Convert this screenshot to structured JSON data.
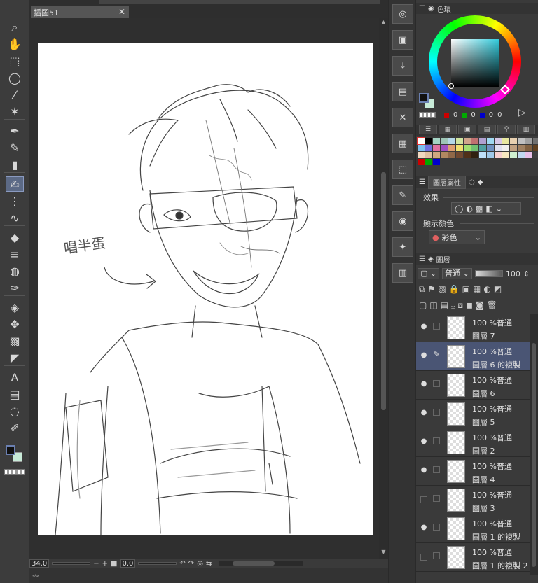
{
  "document": {
    "tab_title": "插圖51",
    "close_glyph": "✕"
  },
  "tools": [
    {
      "name": "zoom-icon",
      "glyph": "⌕"
    },
    {
      "name": "hand-icon",
      "glyph": "✋"
    },
    {
      "name": "object-select-icon",
      "glyph": "⬚"
    },
    {
      "name": "lasso-icon",
      "glyph": "◯"
    },
    {
      "name": "eyedropper-icon",
      "glyph": "⁄"
    },
    {
      "name": "auto-select-icon",
      "glyph": "✶"
    },
    {
      "name": "pen-icon",
      "glyph": "✒"
    },
    {
      "name": "pencil-icon",
      "glyph": "✎"
    },
    {
      "name": "brush-icon",
      "glyph": "▮"
    },
    {
      "name": "marker-icon",
      "glyph": "✍"
    },
    {
      "name": "airbrush-icon",
      "glyph": "⋮"
    },
    {
      "name": "decoration-icon",
      "glyph": "∿"
    },
    {
      "name": "eraser-icon",
      "glyph": "◆"
    },
    {
      "name": "blend-icon",
      "glyph": "≡"
    },
    {
      "name": "fill-icon",
      "glyph": "◍"
    },
    {
      "name": "vector-pen-icon",
      "glyph": "✑"
    },
    {
      "name": "fill-bucket-icon",
      "glyph": "◈"
    },
    {
      "name": "move-icon",
      "glyph": "✥"
    },
    {
      "name": "gradient-icon",
      "glyph": "▩"
    },
    {
      "name": "figure-icon",
      "glyph": "◤"
    },
    {
      "name": "text-icon",
      "glyph": "A"
    },
    {
      "name": "frame-icon",
      "glyph": "▤"
    },
    {
      "name": "balloon-icon",
      "glyph": "◌"
    },
    {
      "name": "correct-line-icon",
      "glyph": "✐"
    }
  ],
  "status": {
    "zoom": "34.0",
    "minus": "−",
    "plus": "+",
    "rotation": "0.0"
  },
  "commands": [
    {
      "name": "new-icon",
      "glyph": "◎"
    },
    {
      "name": "open-icon",
      "glyph": "▣"
    },
    {
      "name": "save-icon",
      "glyph": "⤓"
    },
    {
      "name": "save-as-icon",
      "glyph": "▤"
    },
    {
      "name": "clear-icon",
      "glyph": "✕"
    },
    {
      "name": "fill-grid-icon",
      "glyph": "▦"
    },
    {
      "name": "transform-icon",
      "glyph": "⬚"
    },
    {
      "name": "edit-icon",
      "glyph": "✎"
    },
    {
      "name": "photo-icon",
      "glyph": "◉"
    },
    {
      "name": "figure-pose-icon",
      "glyph": "✦"
    },
    {
      "name": "export-icon",
      "glyph": "▥"
    }
  ],
  "color_panel": {
    "title": "色環",
    "rgb": [
      {
        "color": "#cc0000",
        "value": "0"
      },
      {
        "color": "#00aa00",
        "value": "0"
      },
      {
        "color": "#0000cc",
        "value": "0"
      },
      {
        "color": "",
        "value": "0"
      }
    ]
  },
  "palette_colors": [
    "#ffffff",
    "#000000",
    "#a4d4c4",
    "#9ec6b6",
    "#b4d8e8",
    "#cfe6a0",
    "#d0a58c",
    "#c07070",
    "#b0a0d0",
    "#a0d8f0",
    "#d8c8e8",
    "#e8e8a0",
    "#e8d0b0",
    "#c0c0c0",
    "#a0a0a0",
    "#707070",
    "#80c0f0",
    "#7070e0",
    "#e070a0",
    "#a050c0",
    "#e0a070",
    "#f0e070",
    "#a0e070",
    "#70c070",
    "#50a0a0",
    "#7090c0",
    "#e0e0f0",
    "#f0f0f0",
    "#c0a080",
    "#a08060",
    "#806040",
    "#604020",
    "#f0d8c0",
    "#e0c0a0",
    "#d0a880",
    "#b08860",
    "#906848",
    "#704830",
    "#503018",
    "#302010",
    "#c0e0f8",
    "#a0c8e8",
    "#f8d0d0",
    "#f8e8c0",
    "#d0f0d0",
    "#c0d8f0",
    "#e8c0e8",
    "#404040",
    "#cc0000",
    "#00aa00",
    "#0000cc"
  ],
  "properties_panel": {
    "tab_label": "圖層屬性",
    "effect_label": "效果",
    "display_color_label": "顯示顏色",
    "display_color_value": "彩色"
  },
  "layer_panel": {
    "title": "圖層",
    "blend_mode": "普通",
    "opacity": "100"
  },
  "layers": [
    {
      "mode": "100 %普通",
      "name": "圖層 7",
      "visible": "●",
      "selected": false,
      "editing": ""
    },
    {
      "mode": "100 %普通",
      "name": "圖層 6 的複製",
      "visible": "●",
      "selected": true,
      "editing": "✎"
    },
    {
      "mode": "100 %普通",
      "name": "圖層 6",
      "visible": "●",
      "selected": false,
      "editing": ""
    },
    {
      "mode": "100 %普通",
      "name": "圖層 5",
      "visible": "●",
      "selected": false,
      "editing": ""
    },
    {
      "mode": "100 %普通",
      "name": "圖層 2",
      "visible": "●",
      "selected": false,
      "editing": ""
    },
    {
      "mode": "100 %普通",
      "name": "圖層 4",
      "visible": "●",
      "selected": false,
      "editing": ""
    },
    {
      "mode": "100 %普通",
      "name": "圖層 3",
      "visible": "",
      "selected": false,
      "editing": ""
    },
    {
      "mode": "100 %普通",
      "name": "圖層 1 的複製",
      "visible": "●",
      "selected": false,
      "editing": ""
    },
    {
      "mode": "100 %普通",
      "name": "圖層 1 的複製 2",
      "visible": "",
      "selected": false,
      "editing": ""
    }
  ],
  "sketch_text": "唱半蛋"
}
